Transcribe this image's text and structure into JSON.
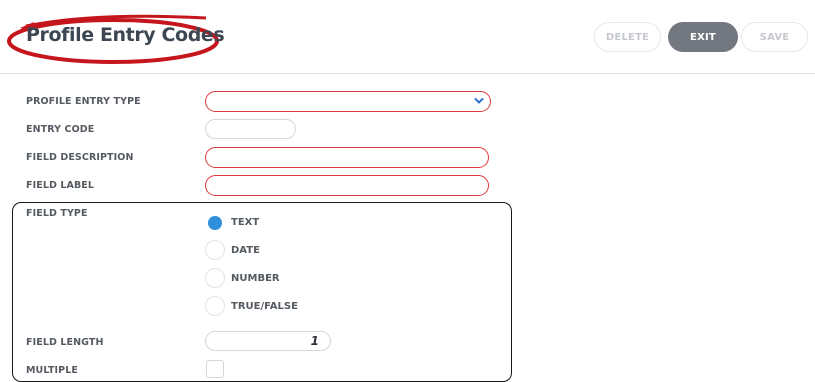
{
  "header": {
    "title": "Profile Entry Codes",
    "buttons": {
      "delete": "DELETE",
      "exit": "EXIT",
      "save": "SAVE"
    }
  },
  "form": {
    "profile_entry_type": {
      "label": "PROFILE ENTRY TYPE",
      "value": "",
      "required": true,
      "icon": "chevron-down-icon"
    },
    "entry_code": {
      "label": "ENTRY CODE",
      "value": ""
    },
    "field_description": {
      "label": "FIELD DESCRIPTION",
      "value": "",
      "required": true
    },
    "field_label": {
      "label": "FIELD LABEL",
      "value": "",
      "required": true
    },
    "field_type": {
      "label": "FIELD TYPE",
      "options": [
        "TEXT",
        "DATE",
        "NUMBER",
        "TRUE/FALSE"
      ],
      "selected": "TEXT"
    },
    "field_length": {
      "label": "FIELD LENGTH",
      "value": "1"
    },
    "multiple": {
      "label": "MULTIPLE",
      "checked": false
    }
  },
  "colors": {
    "required_border": "#e03a3e",
    "annotation_red": "#c4161c",
    "radio_selected": "#2f8fdc",
    "exit_button": "#737880",
    "title_text": "#3d4754"
  }
}
